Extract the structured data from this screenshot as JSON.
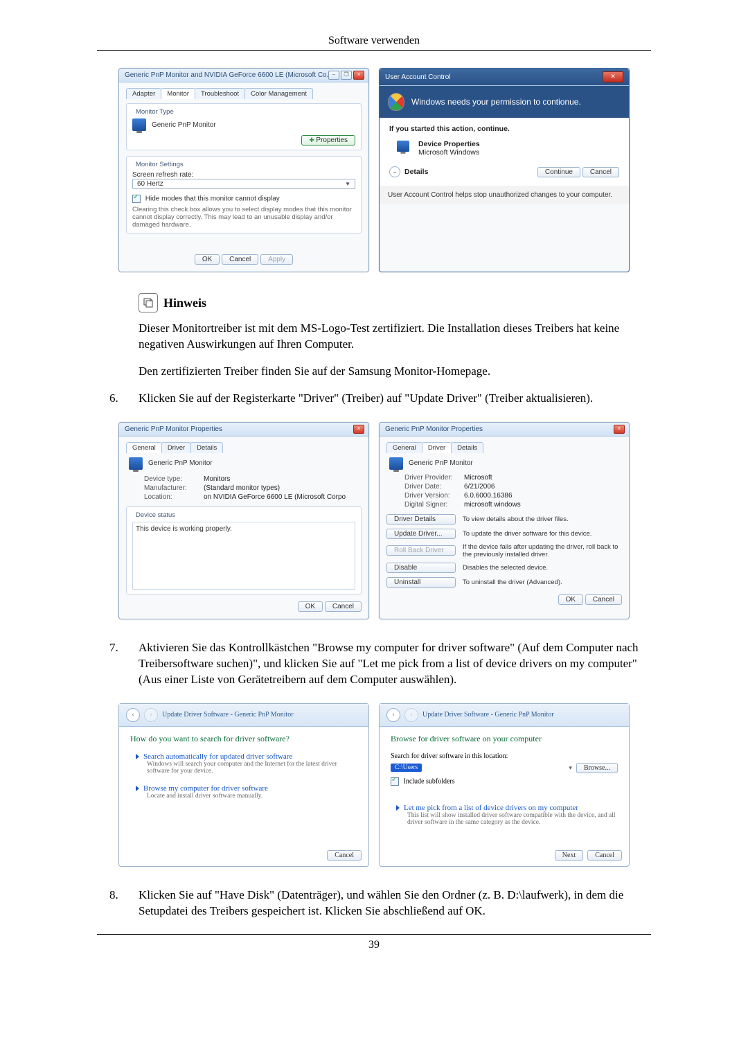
{
  "header": {
    "title": "Software verwenden"
  },
  "page_number": "39",
  "fig1": {
    "properties": {
      "title": "Generic PnP Monitor and NVIDIA GeForce 6600 LE (Microsoft Co...",
      "tabs": [
        "Adapter",
        "Monitor",
        "Troubleshoot",
        "Color Management"
      ],
      "monitor_type_legend": "Monitor Type",
      "monitor_type_value": "Generic PnP Monitor",
      "properties_btn": "Properties",
      "monitor_settings_legend": "Monitor Settings",
      "refresh_label": "Screen refresh rate:",
      "refresh_value": "60 Hertz",
      "hide_modes": "Hide modes that this monitor cannot display",
      "hide_modes_desc": "Clearing this check box allows you to select display modes that this monitor cannot display correctly. This may lead to an unusable display and/or damaged hardware.",
      "ok": "OK",
      "cancel": "Cancel",
      "apply": "Apply"
    },
    "uac": {
      "title": "User Account Control",
      "banner": "Windows needs your permission to contionue.",
      "started": "If you started this action, continue.",
      "app_name": "Device Properties",
      "publisher": "Microsoft Windows",
      "details": "Details",
      "continue": "Continue",
      "cancel": "Cancel",
      "footer": "User Account Control helps stop unauthorized changes to your computer."
    }
  },
  "note": {
    "title": "Hinweis",
    "para1": "Dieser Monitortreiber ist mit dem MS-Logo-Test zertifiziert. Die Installation dieses Treibers hat keine negativen Auswirkungen auf Ihren Computer.",
    "para2": "Den zertifizierten Treiber finden Sie auf der Samsung Monitor-Homepage."
  },
  "steps": {
    "s6_num": "6.",
    "s6": "Klicken Sie auf der Registerkarte \"Driver\" (Treiber) auf \"Update Driver\" (Treiber aktualisieren).",
    "s7_num": "7.",
    "s7": "Aktivieren Sie das Kontrollkästchen \"Browse my computer for driver software\" (Auf dem Computer nach Treibersoftware suchen)\", und klicken Sie auf \"Let me pick from a list of device drivers on my computer\" (Aus einer Liste von Gerätetreibern auf dem Computer auswählen).",
    "s8_num": "8.",
    "s8": "Klicken Sie auf \"Have Disk\" (Datenträger), und wählen Sie den Ordner (z. B. D:\\laufwerk), in dem die Setupdatei des Treibers gespeichert ist. Klicken Sie abschließend auf OK."
  },
  "fig2": {
    "left": {
      "title": "Generic PnP Monitor Properties",
      "tabs": [
        "General",
        "Driver",
        "Details"
      ],
      "header": "Generic PnP Monitor",
      "device_type_k": "Device type:",
      "device_type_v": "Monitors",
      "manufacturer_k": "Manufacturer:",
      "manufacturer_v": "(Standard monitor types)",
      "location_k": "Location:",
      "location_v": "on NVIDIA GeForce 6600 LE (Microsoft Corpo",
      "status_legend": "Device status",
      "status_text": "This device is working properly.",
      "ok": "OK",
      "cancel": "Cancel"
    },
    "right": {
      "title": "Generic PnP Monitor Properties",
      "tabs": [
        "General",
        "Driver",
        "Details"
      ],
      "header": "Generic PnP Monitor",
      "provider_k": "Driver Provider:",
      "provider_v": "Microsoft",
      "date_k": "Driver Date:",
      "date_v": "6/21/2006",
      "version_k": "Driver Version:",
      "version_v": "6.0.6000.16386",
      "signer_k": "Digital Signer:",
      "signer_v": "microsoft windows",
      "btn_details": "Driver Details",
      "desc_details": "To view details about the driver files.",
      "btn_update": "Update Driver...",
      "desc_update": "To update the driver software for this device.",
      "btn_rollback": "Roll Back Driver",
      "desc_rollback": "If the device fails after updating the driver, roll back to the previously installed driver.",
      "btn_disable": "Disable",
      "desc_disable": "Disables the selected device.",
      "btn_uninstall": "Uninstall",
      "desc_uninstall": "To uninstall the driver (Advanced).",
      "ok": "OK",
      "cancel": "Cancel"
    }
  },
  "fig3": {
    "left": {
      "title": "Update Driver Software - Generic PnP Monitor",
      "question": "How do you want to search for driver software?",
      "opt1_t": "Search automatically for updated driver software",
      "opt1_d": "Windows will search your computer and the Internet for the latest driver software for your device.",
      "opt2_t": "Browse my computer for driver software",
      "opt2_d": "Locate and install driver software manually.",
      "cancel": "Cancel"
    },
    "right": {
      "title": "Update Driver Software - Generic PnP Monitor",
      "heading": "Browse for driver software on your computer",
      "search_label": "Search for driver software in this location:",
      "path": "C:\\Users",
      "browse": "Browse...",
      "include": "Include subfolders",
      "opt_t": "Let me pick from a list of device drivers on my computer",
      "opt_d": "This list will show installed driver software compatible with the device, and all driver software in the same category as the device.",
      "next": "Next",
      "cancel": "Cancel"
    }
  }
}
